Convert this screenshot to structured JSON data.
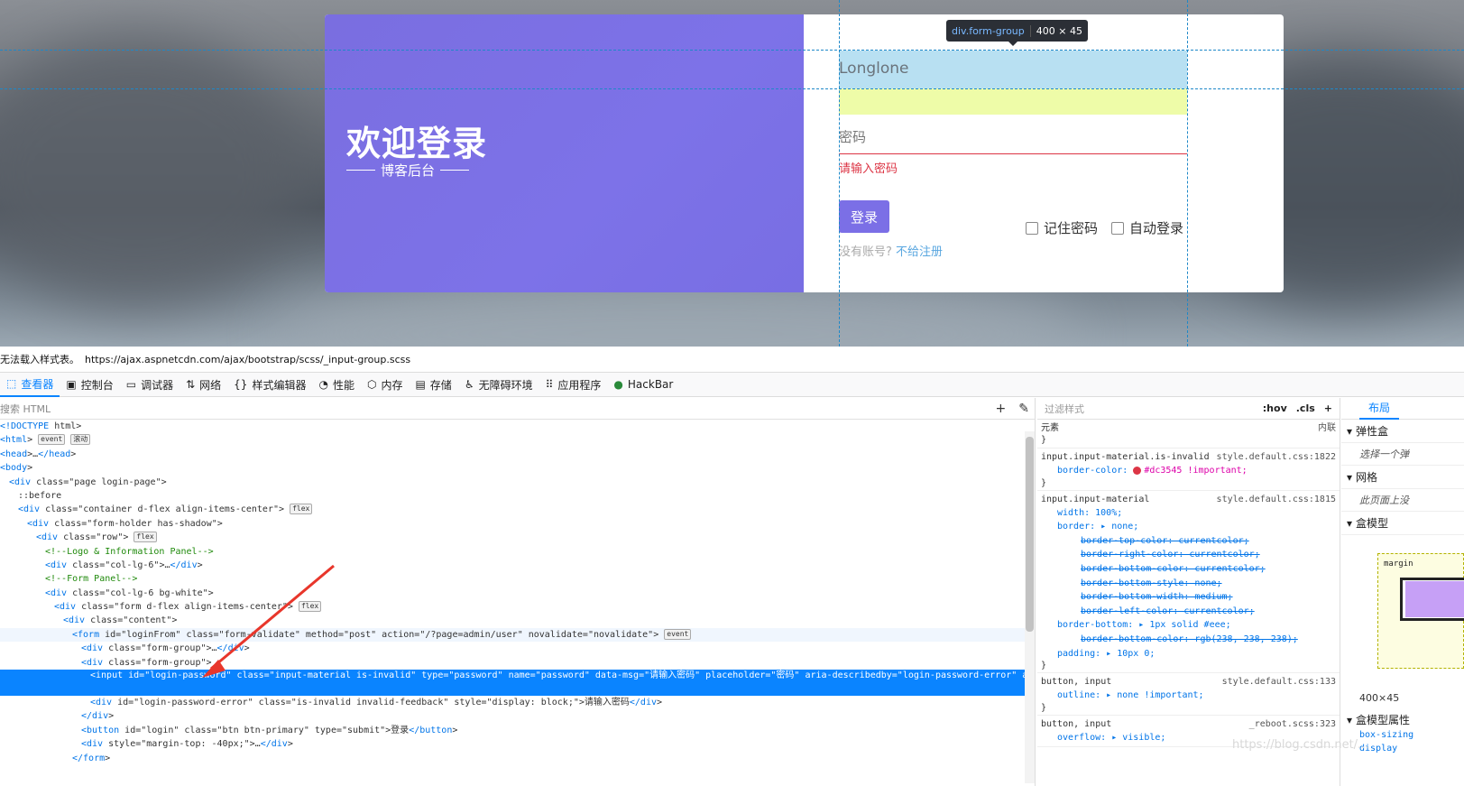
{
  "page": {
    "welcome_title": "欢迎登录",
    "welcome_subtitle": "博客后台",
    "username_value": "Longlone",
    "password_placeholder": "密码",
    "password_error": "请输入密码",
    "login_button": "登录",
    "no_account": "没有账号?",
    "register_link": "不给注册",
    "remember_password": "记住密码",
    "auto_login": "自动登录",
    "accent_color": "#7b6fe6",
    "error_color": "#dc3545"
  },
  "tooltip": {
    "tag": "div.form-group",
    "size": "400 × 45"
  },
  "notice": {
    "label": "无法载入样式表。",
    "url": "https://ajax.aspnetcdn.com/ajax/bootstrap/scss/_input-group.scss"
  },
  "devtools": {
    "tabs": [
      {
        "label": "查看器",
        "icon": "inspector-icon"
      },
      {
        "label": "控制台",
        "icon": "console-icon"
      },
      {
        "label": "调试器",
        "icon": "debugger-icon"
      },
      {
        "label": "网络",
        "icon": "network-icon"
      },
      {
        "label": "样式编辑器",
        "icon": "style-editor-icon"
      },
      {
        "label": "性能",
        "icon": "performance-icon"
      },
      {
        "label": "内存",
        "icon": "memory-icon"
      },
      {
        "label": "存储",
        "icon": "storage-icon"
      },
      {
        "label": "无障碍环境",
        "icon": "accessibility-icon"
      },
      {
        "label": "应用程序",
        "icon": "application-icon"
      },
      {
        "label": "HackBar",
        "icon": "hackbar-icon"
      }
    ],
    "search_html_placeholder": "搜索 HTML",
    "filter_styles_placeholder": "过滤样式",
    "hov": ":hov",
    "cls": ".cls",
    "layout_tab": "布局",
    "tree_rows": [
      "<!DOCTYPE html>",
      "<html>",
      "<head>…</head>",
      "<body>",
      "<div class=\"page login-page\">",
      "::before",
      "<div class=\"container d-flex align-items-center\">",
      "<div class=\"form-holder has-shadow\">",
      "<div class=\"row\">",
      "<!--Logo & Information Panel-->",
      "<div class=\"col-lg-6\">…</div>",
      "<!--Form Panel-->",
      "<div class=\"col-lg-6 bg-white\">",
      "<div class=\"form d-flex align-items-center\">",
      "<div class=\"content\">",
      "<form id=\"loginFrom\" class=\"form-validate\" method=\"post\" action=\"/?page=admin/user\" novalidate=\"novalidate\">",
      "<div class=\"form-group\">…</div>",
      "<div class=\"form-group\">",
      "<input id=\"login-password\" class=\"input-material is-invalid\" type=\"password\" name=\"password\" data-msg=\"请输入密码\" placeholder=\"密码\" aria-describedby=\"login-password-error\" aria-invalid=\"true\">",
      "<div id=\"login-password-error\" class=\"is-invalid invalid-feedback\" style=\"display: block;\">请输入密码</div>",
      "</div>",
      "<button id=\"login\" class=\"btn btn-primary\" type=\"submit\">登录</button>",
      "<div style=\"margin-top: -40px;\">…</div>",
      "</form>"
    ],
    "badges": {
      "event": "event",
      "scroll": "滚动",
      "flex": "flex"
    },
    "rules": {
      "element_label": "元素",
      "element_source": "内联",
      "r1_selector": "input.input-material.is-invalid",
      "r1_source": "style.default.css:1822",
      "r1_decl": "border-color:",
      "r1_value": "#dc3545 !important;",
      "r2_selector": "input.input-material",
      "r2_source": "style.default.css:1815",
      "r2_decls": [
        "width: 100%;",
        "border: ▸ none;"
      ],
      "r2_struck": [
        "border-top-color: currentcolor;",
        "border-right-color: currentcolor;",
        "border-bottom-color: currentcolor;",
        "border-bottom-style: none;",
        "border-bottom-width: medium;",
        "border-left-color: currentcolor;"
      ],
      "r2_bottom": "border-bottom: ▸ 1px solid #eee;",
      "r2_bottom_struck": "border-bottom-color: rgb(238, 238, 238);",
      "r2_padding": "padding: ▸ 10px 0;",
      "r3_selector": "button, input",
      "r3_source": "style.default.css:133",
      "r3_decl": "outline: ▸ none !important;",
      "r4_selector": "button, input",
      "r4_source": "_reboot.scss:323",
      "r4_decl": "overflow: ▸ visible;"
    },
    "layout": {
      "flexbox": "弹性盒",
      "flexbox_note": "选择一个弹",
      "grid": "网格",
      "grid_note": "此页面上没",
      "box_model": "盒模型",
      "margin_label": "margin",
      "size": "400×45",
      "box_props": "盒模型属性",
      "prop1": "box-sizing",
      "prop2": "display"
    },
    "watermark": "https://blog.csdn.net/..."
  }
}
